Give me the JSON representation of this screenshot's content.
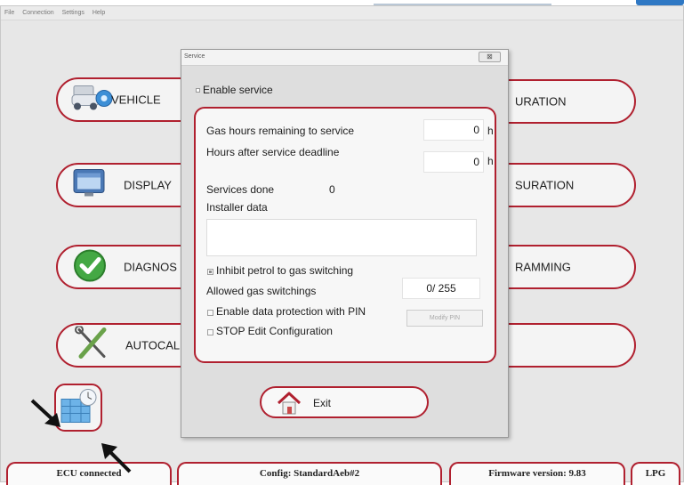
{
  "menu": [
    "File",
    "Connection",
    "Settings",
    "Help"
  ],
  "main_buttons": {
    "vehicle": "VEHICLE",
    "display": "DISPLAY",
    "diagnostics": "DIAGNOS",
    "autocal": "AUTOCAL",
    "configuration1": "URATION",
    "configuration2": "SURATION",
    "programming": "RAMMING"
  },
  "dialog": {
    "title": "Service",
    "close_glyph": "⊠",
    "enable_service": "Enable service",
    "gas_hours_label": "Gas hours remaining to service",
    "gas_hours_value": "0",
    "hours_after_label": "Hours after service deadline",
    "hours_after_value": "0",
    "unit_hours": "h",
    "services_done_label": "Services done",
    "services_done_value": "0",
    "installer_data_label": "Installer data",
    "installer_data_value": "",
    "inhibit_label": "Inhibit petrol to gas switching",
    "inhibit_checked": true,
    "allowed_switchings_label": "Allowed gas switchings",
    "allowed_switchings_value": "0/ 255",
    "data_protection_label": "Enable data protection with PIN",
    "data_protection_checked": false,
    "modify_pin_label": "Modify PIN",
    "stop_edit_label": "STOP Edit Configuration",
    "stop_edit_checked": false,
    "exit_label": "Exit"
  },
  "status_bar": {
    "connection": "ECU connected",
    "config": "Config: StandardAeb#2",
    "firmware": "Firmware version: 9.83",
    "fuel": "LPG"
  },
  "colors": {
    "accent_red": "#b0202f",
    "window_bg": "#e7e7e7",
    "title_blue": "#2f78c4"
  },
  "icons": {
    "vehicle": "car-gear-icon",
    "display": "monitor-icon",
    "diagnostics": "green-check-icon",
    "autocal": "tools-icon",
    "calendar": "calendar-clock-icon",
    "exit": "home-icon"
  }
}
